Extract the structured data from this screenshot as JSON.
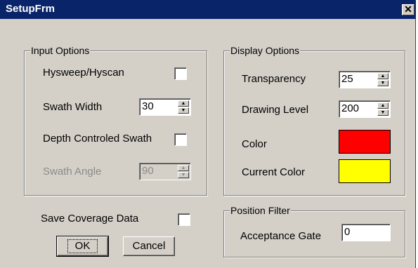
{
  "window": {
    "title": "SetupFrm",
    "close_glyph": "✕",
    "close_icon": "close-icon"
  },
  "input_options": {
    "legend": "Input Options",
    "hysweep_label": "Hysweep/Hyscan",
    "swath_width_label": "Swath Width",
    "swath_width_value": "30",
    "depth_controlled_label": "Depth Controled Swath",
    "swath_angle_label": "Swath Angle",
    "swath_angle_value": "90"
  },
  "display_options": {
    "legend": "Display Options",
    "transparency_label": "Transparency",
    "transparency_value": "25",
    "drawing_level_label": "Drawing Level",
    "drawing_level_value": "200",
    "color_label": "Color",
    "color_value": "#ff0000",
    "current_color_label": "Current Color",
    "current_color_value": "#ffff00"
  },
  "save_coverage_label": "Save Coverage Data",
  "position_filter": {
    "legend": "Position Filter",
    "acceptance_gate_label": "Acceptance Gate",
    "acceptance_gate_value": "0"
  },
  "buttons": {
    "ok": "OK",
    "cancel": "Cancel"
  }
}
